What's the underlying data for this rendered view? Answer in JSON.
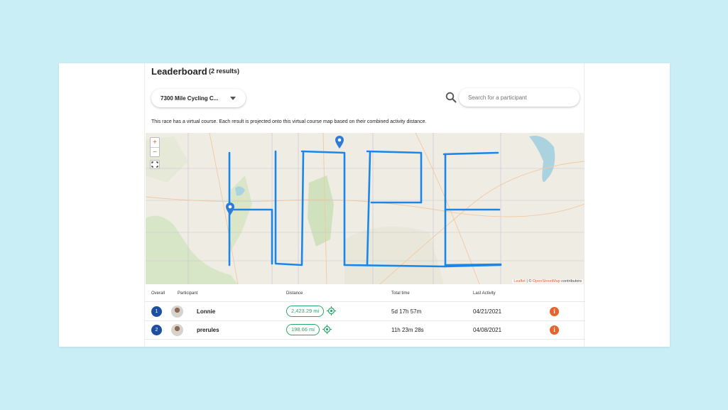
{
  "leaderboard": {
    "title": "Leaderboard",
    "results": "(2 results)",
    "course_select": "7300 Mile Cycling C...",
    "search_placeholder": "Search for a participant",
    "note": "This race has a virtual course. Each result is projected onto this virtual course map based on their combined activity distance."
  },
  "map": {
    "zoom_in": "+",
    "zoom_out": "−",
    "attribution_leaflet": "Leaflet",
    "attribution_sep": " | © ",
    "attribution_osm": "OpenStreetMap",
    "attribution_suffix": " contributors",
    "route_color": "#1a86ea",
    "marker_color": "#2c7bd6"
  },
  "table": {
    "headers": [
      "Overall",
      "Participant",
      "Distance",
      "Total time",
      "Last Activity"
    ],
    "rows": [
      {
        "rank": "1",
        "name": "Lonnie",
        "distance": "2,423.29 mi",
        "time": "5d 17h 57m",
        "last": "04/21/2021"
      },
      {
        "rank": "2",
        "name": "prerules",
        "distance": "198.66 mi",
        "time": "11h 23m 28s",
        "last": "04/08/2021"
      }
    ]
  },
  "icons": {
    "search": "search-icon",
    "caret": "chevron-down-icon",
    "target": "locate-icon",
    "info": "info-icon",
    "info_glyph": "i",
    "fullscreen": "fullscreen-icon",
    "marker": "map-marker-icon"
  },
  "colors": {
    "background": "#c9eef6",
    "accent": "#e8622b",
    "distance": "#28a86b",
    "rank": "#1e4fa0"
  }
}
